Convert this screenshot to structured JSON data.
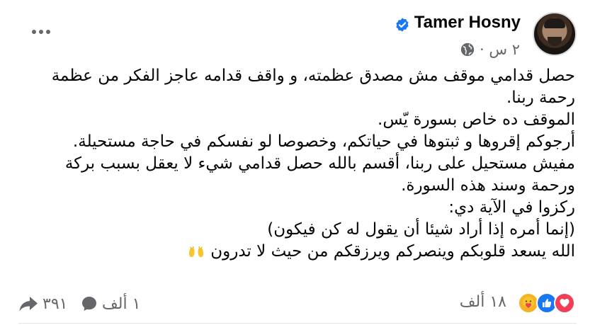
{
  "post": {
    "author": "Tamer Hosny",
    "verified": true,
    "timestamp": "٢ س ·",
    "privacy_icon": "globe-icon",
    "lines": [
      "حصل قدامي موقف مش مصدق عظمته، و واقف قدامه عاجز الفكر من عظمة",
      "رحمة ربنا.",
      "الموقف ده خاص بسورة يّس.",
      "أرجوكم إقروها و ثبتوها في حياتكم، وخصوصا لو نفسكم في حاجة مستحيلة.",
      "مفيش مستحيل على ربنا، أقسم بالله حصل قدامي شيء لا يعقل بسبب بركة",
      "ورحمة وسند هذه السورة.",
      "ركزوا في الآية دي:",
      "(إنما أمره إذا أراد شيئا أن يقول له كن فيكون)",
      "الله يسعد قلوبكم وينصركم ويرزقكم من حيث لا تدرون"
    ],
    "emoji_last_line": "raising-hands"
  },
  "footer": {
    "reactions": [
      "love",
      "like",
      "care"
    ],
    "reaction_count": "١٨ ألف",
    "comment_count": "١ ألف",
    "share_count": "٣٩١"
  },
  "colors": {
    "secondary_text": "#65676b",
    "verified_blue": "#1877f2",
    "love_red": "#f33e58",
    "like_blue": "#1877f2",
    "care_yellow": "#f7b125"
  }
}
